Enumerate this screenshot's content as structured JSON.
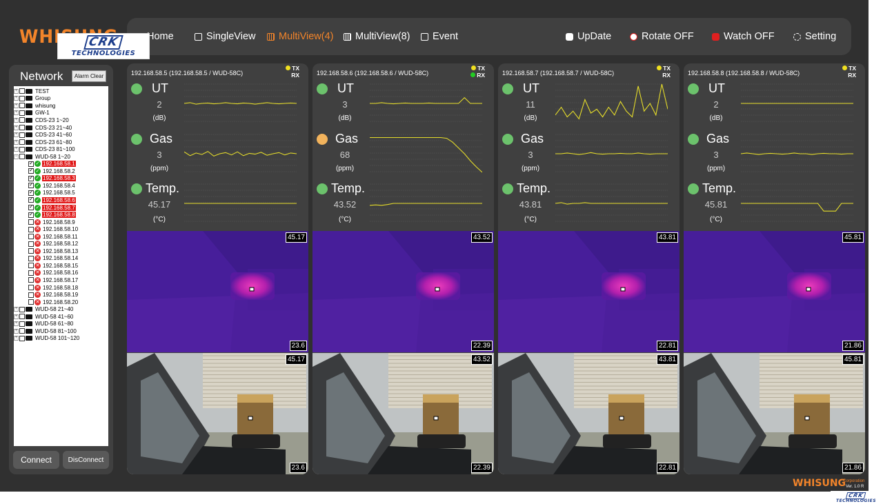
{
  "brand": "WHISUNG",
  "watermark": {
    "line1": "CRK",
    "line2": "TECHNOLOGIES"
  },
  "nav": {
    "home": "Home",
    "single_view": "SingleView",
    "multi_view_4": "MultiView(4)",
    "multi_view_8": "MultiView(8)",
    "event": "Event",
    "update": "UpDate",
    "rotate": "Rotate OFF",
    "watch": "Watch OFF",
    "setting": "Setting"
  },
  "colors": {
    "accent": "#f2842a",
    "alarm": "#e01818",
    "ok": "#22aa22",
    "status_green": "#6cc26c",
    "status_amber": "#f2b35c"
  },
  "network": {
    "title": "Network",
    "alarm_clear": "Alarm Clear",
    "connect": "Connect",
    "disconnect": "DisConnect",
    "groups_top": [
      "TEST",
      "Group",
      "whisung",
      "GW-1",
      "CDS-23 1~20",
      "CDS-23 21~40",
      "CDS-23 41~60",
      "CDS-23 61~80",
      "CDS-23 81~100",
      "WUD-58 1~20"
    ],
    "devices": [
      {
        "label": "192.168.58.1",
        "checked": true,
        "ok": true,
        "alarm": true
      },
      {
        "label": "192.168.58.2",
        "checked": true,
        "ok": true,
        "alarm": false
      },
      {
        "label": "192.168.58.3",
        "checked": true,
        "ok": true,
        "alarm": true
      },
      {
        "label": "192.168.58.4",
        "checked": true,
        "ok": true,
        "alarm": false
      },
      {
        "label": "192.168.58.5",
        "checked": true,
        "ok": true,
        "alarm": false
      },
      {
        "label": "192.168.58.6",
        "checked": true,
        "ok": true,
        "alarm": true
      },
      {
        "label": "192.168.58.7",
        "checked": true,
        "ok": true,
        "alarm": true
      },
      {
        "label": "192.168.58.8",
        "checked": true,
        "ok": true,
        "alarm": true
      },
      {
        "label": "192.168.58.9",
        "checked": false,
        "ok": false,
        "alarm": false
      },
      {
        "label": "192.168.58.10",
        "checked": false,
        "ok": false,
        "alarm": false
      },
      {
        "label": "192.168.58.11",
        "checked": false,
        "ok": false,
        "alarm": false
      },
      {
        "label": "192.168.58.12",
        "checked": false,
        "ok": false,
        "alarm": false
      },
      {
        "label": "192.168.58.13",
        "checked": false,
        "ok": false,
        "alarm": false
      },
      {
        "label": "192.168.58.14",
        "checked": false,
        "ok": false,
        "alarm": false
      },
      {
        "label": "192.168.58.15",
        "checked": false,
        "ok": false,
        "alarm": false
      },
      {
        "label": "192.168.58.16",
        "checked": false,
        "ok": false,
        "alarm": false
      },
      {
        "label": "192.168.58.17",
        "checked": false,
        "ok": false,
        "alarm": false
      },
      {
        "label": "192.168.58.18",
        "checked": false,
        "ok": false,
        "alarm": false
      },
      {
        "label": "192.168.58.19",
        "checked": false,
        "ok": false,
        "alarm": false
      },
      {
        "label": "192.168.58.20",
        "checked": false,
        "ok": false,
        "alarm": false
      }
    ],
    "groups_bottom": [
      "WUD-58 21~40",
      "WUD-58 41~60",
      "WUD-58 61~80",
      "WUD-58 81~100",
      "WUD-58 101~120"
    ]
  },
  "panel_labels": {
    "tx": "TX",
    "rx": "RX",
    "ut": "UT",
    "gas": "Gas",
    "temp": "Temp.",
    "ut_unit": "(dB)",
    "gas_unit": "(ppm)",
    "temp_unit": "(°C)"
  },
  "panels": [
    {
      "header": "192.168.58.5 (192.168.58.5 / WUD-58C)",
      "rx_active": false,
      "ut": "2",
      "gas": "3",
      "gas_warn": false,
      "temp": "45.17",
      "thermal_max": "45.17",
      "thermal_min": "23.6",
      "cam_max": "45.17",
      "cam_min": "23.6",
      "ut_trend": [
        0.5,
        0.52,
        0.48,
        0.5,
        0.51,
        0.49,
        0.5,
        0.52,
        0.5,
        0.49,
        0.51,
        0.5,
        0.48,
        0.5,
        0.52,
        0.5,
        0.49,
        0.5,
        0.51,
        0.5
      ],
      "gas_trend": [
        0.55,
        0.45,
        0.52,
        0.48,
        0.56,
        0.44,
        0.5,
        0.53,
        0.47,
        0.55,
        0.45,
        0.51,
        0.49,
        0.54,
        0.46,
        0.5,
        0.53,
        0.47,
        0.52,
        0.5
      ],
      "temp_trend": [
        0.5,
        0.5,
        0.5,
        0.5,
        0.5,
        0.5,
        0.5,
        0.5,
        0.5,
        0.5,
        0.5,
        0.5,
        0.5,
        0.5,
        0.5,
        0.5,
        0.5,
        0.5,
        0.5,
        0.5
      ]
    },
    {
      "header": "192.168.58.6 (192.168.58.6 / WUD-58C)",
      "rx_active": true,
      "ut": "3",
      "gas": "68",
      "gas_warn": true,
      "temp": "43.52",
      "thermal_max": "43.52",
      "thermal_min": "22.39",
      "cam_max": "43.52",
      "cam_min": "22.39",
      "ut_trend": [
        0.5,
        0.5,
        0.52,
        0.5,
        0.49,
        0.5,
        0.51,
        0.5,
        0.5,
        0.5,
        0.51,
        0.5,
        0.5,
        0.5,
        0.5,
        0.5,
        0.65,
        0.5,
        0.5,
        0.5
      ],
      "gas_trend": [
        0.92,
        0.92,
        0.92,
        0.92,
        0.92,
        0.92,
        0.92,
        0.92,
        0.92,
        0.92,
        0.92,
        0.92,
        0.92,
        0.9,
        0.8,
        0.65,
        0.5,
        0.32,
        0.16,
        0.02
      ],
      "temp_trend": [
        0.45,
        0.46,
        0.45,
        0.47,
        0.5,
        0.5,
        0.5,
        0.5,
        0.5,
        0.5,
        0.5,
        0.5,
        0.5,
        0.5,
        0.5,
        0.5,
        0.5,
        0.5,
        0.5,
        0.5
      ]
    },
    {
      "header": "192.168.58.7 (192.168.58.7 / WUD-58C)",
      "rx_active": false,
      "ut": "11",
      "gas": "3",
      "gas_warn": false,
      "temp": "43.81",
      "thermal_max": "43.81",
      "thermal_min": "22.81",
      "cam_max": "43.81",
      "cam_min": "22.81",
      "ut_trend": [
        0.2,
        0.4,
        0.15,
        0.3,
        0.1,
        0.6,
        0.25,
        0.35,
        0.15,
        0.4,
        0.2,
        0.55,
        0.3,
        0.15,
        0.95,
        0.3,
        0.5,
        0.2,
        1.0,
        0.35
      ],
      "gas_trend": [
        0.5,
        0.5,
        0.52,
        0.5,
        0.48,
        0.5,
        0.53,
        0.5,
        0.49,
        0.5,
        0.5,
        0.51,
        0.5,
        0.5,
        0.52,
        0.5,
        0.49,
        0.5,
        0.5,
        0.5
      ],
      "temp_trend": [
        0.5,
        0.52,
        0.48,
        0.5,
        0.5,
        0.52,
        0.5,
        0.5,
        0.5,
        0.5,
        0.5,
        0.5,
        0.5,
        0.5,
        0.5,
        0.5,
        0.5,
        0.5,
        0.5,
        0.5
      ]
    },
    {
      "header": "192.168.58.8 (192.168.58.8 / WUD-58C)",
      "rx_active": false,
      "ut": "2",
      "gas": "3",
      "gas_warn": false,
      "temp": "45.81",
      "thermal_max": "45.81",
      "thermal_min": "21.86",
      "cam_max": "45.81",
      "cam_min": "21.86",
      "ut_trend": [
        0.5,
        0.5,
        0.5,
        0.5,
        0.5,
        0.5,
        0.5,
        0.5,
        0.5,
        0.5,
        0.5,
        0.5,
        0.5,
        0.5,
        0.5,
        0.5,
        0.5,
        0.5,
        0.5,
        0.5
      ],
      "gas_trend": [
        0.5,
        0.52,
        0.5,
        0.48,
        0.5,
        0.51,
        0.5,
        0.49,
        0.5,
        0.52,
        0.5,
        0.5,
        0.48,
        0.5,
        0.51,
        0.5,
        0.5,
        0.49,
        0.5,
        0.5
      ],
      "temp_trend": [
        0.5,
        0.5,
        0.5,
        0.5,
        0.5,
        0.5,
        0.5,
        0.5,
        0.5,
        0.5,
        0.5,
        0.5,
        0.5,
        0.5,
        0.3,
        0.3,
        0.3,
        0.5,
        0.5,
        0.5
      ]
    }
  ],
  "footer": {
    "brand": "WHISUNG",
    "corporation": "Corporation",
    "version": "Ver. 1.0 R"
  }
}
